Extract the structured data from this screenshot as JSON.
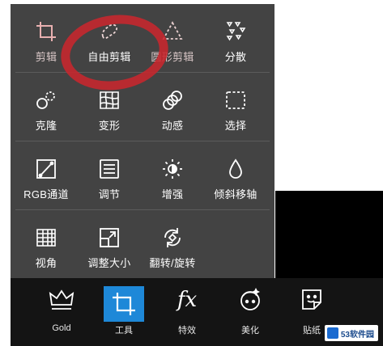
{
  "tool_menu": {
    "rows": [
      [
        {
          "label": "剪辑",
          "icon": "crop-icon"
        },
        {
          "label": "自由剪辑",
          "icon": "freeform-cut-icon"
        },
        {
          "label": "圆形剪辑",
          "icon": "shape-cut-icon"
        },
        {
          "label": "分散",
          "icon": "disperse-icon"
        }
      ],
      [
        {
          "label": "克隆",
          "icon": "clone-icon"
        },
        {
          "label": "变形",
          "icon": "warp-icon"
        },
        {
          "label": "动感",
          "icon": "motion-icon"
        },
        {
          "label": "选择",
          "icon": "select-icon"
        }
      ],
      [
        {
          "label": "RGB通道",
          "icon": "rgb-channel-icon"
        },
        {
          "label": "调节",
          "icon": "adjust-icon"
        },
        {
          "label": "增强",
          "icon": "enhance-icon"
        },
        {
          "label": "倾斜移轴",
          "icon": "tilt-shift-icon"
        }
      ],
      [
        {
          "label": "视角",
          "icon": "perspective-icon"
        },
        {
          "label": "调整大小",
          "icon": "resize-icon"
        },
        {
          "label": "翻转/旋转",
          "icon": "flip-rotate-icon"
        }
      ]
    ]
  },
  "bottom_bar": {
    "tabs": [
      {
        "label": "Gold",
        "icon": "crown-icon"
      },
      {
        "label": "工具",
        "icon": "crop-icon",
        "active": true
      },
      {
        "label": "特效",
        "icon": "fx-icon",
        "glyph": "fx"
      },
      {
        "label": "美化",
        "icon": "face-beautify-icon"
      },
      {
        "label": "贴纸",
        "icon": "sticker-icon"
      }
    ]
  },
  "watermark": {
    "text": "53软件园"
  },
  "colors": {
    "panel": "#434343",
    "bar": "#141414",
    "active_tab": "#1e88d8",
    "annotation": "#c8272e"
  }
}
